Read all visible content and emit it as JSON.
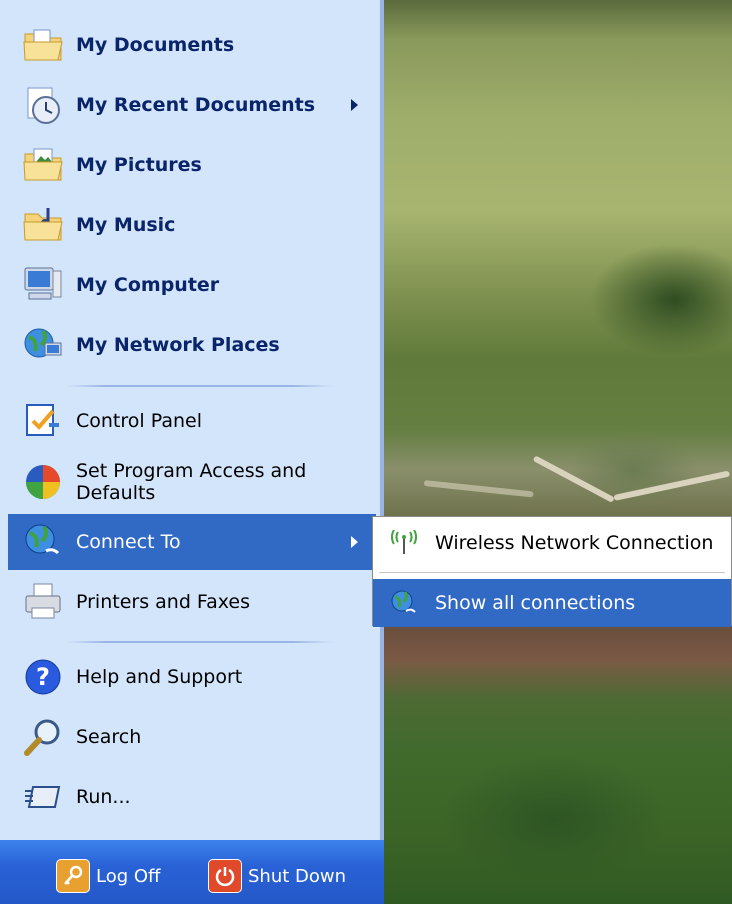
{
  "start_menu": {
    "places": [
      {
        "label": "My Documents",
        "icon": "folder-documents-icon"
      },
      {
        "label": "My Recent Documents",
        "icon": "recent-documents-icon",
        "has_submenu": true
      },
      {
        "label": "My Pictures",
        "icon": "folder-pictures-icon"
      },
      {
        "label": "My Music",
        "icon": "folder-music-icon"
      },
      {
        "label": "My Computer",
        "icon": "computer-icon"
      },
      {
        "label": "My Network Places",
        "icon": "network-places-icon"
      }
    ],
    "tools": [
      {
        "label": "Control Panel",
        "icon": "control-panel-icon"
      },
      {
        "label": "Set Program Access and Defaults",
        "icon": "program-access-icon"
      },
      {
        "label": "Connect To",
        "icon": "connect-to-icon",
        "has_submenu": true,
        "highlighted": true
      },
      {
        "label": "Printers and Faxes",
        "icon": "printer-icon"
      }
    ],
    "help": [
      {
        "label": "Help and Support",
        "icon": "help-icon"
      },
      {
        "label": "Search",
        "icon": "search-icon"
      },
      {
        "label": "Run...",
        "icon": "run-icon"
      }
    ],
    "bottom": {
      "log_off": "Log Off",
      "shut_down": "Shut Down"
    }
  },
  "connect_submenu": {
    "items": [
      {
        "label": "Wireless Network Connection",
        "icon": "wireless-icon"
      },
      {
        "label": "Show all connections",
        "icon": "network-connections-icon",
        "highlighted": true
      }
    ]
  },
  "colors": {
    "menu_bg": "#d3e5fa",
    "highlight": "#316ac5",
    "bottom_bar": "#2458c8",
    "bold_text": "#0a246a"
  }
}
